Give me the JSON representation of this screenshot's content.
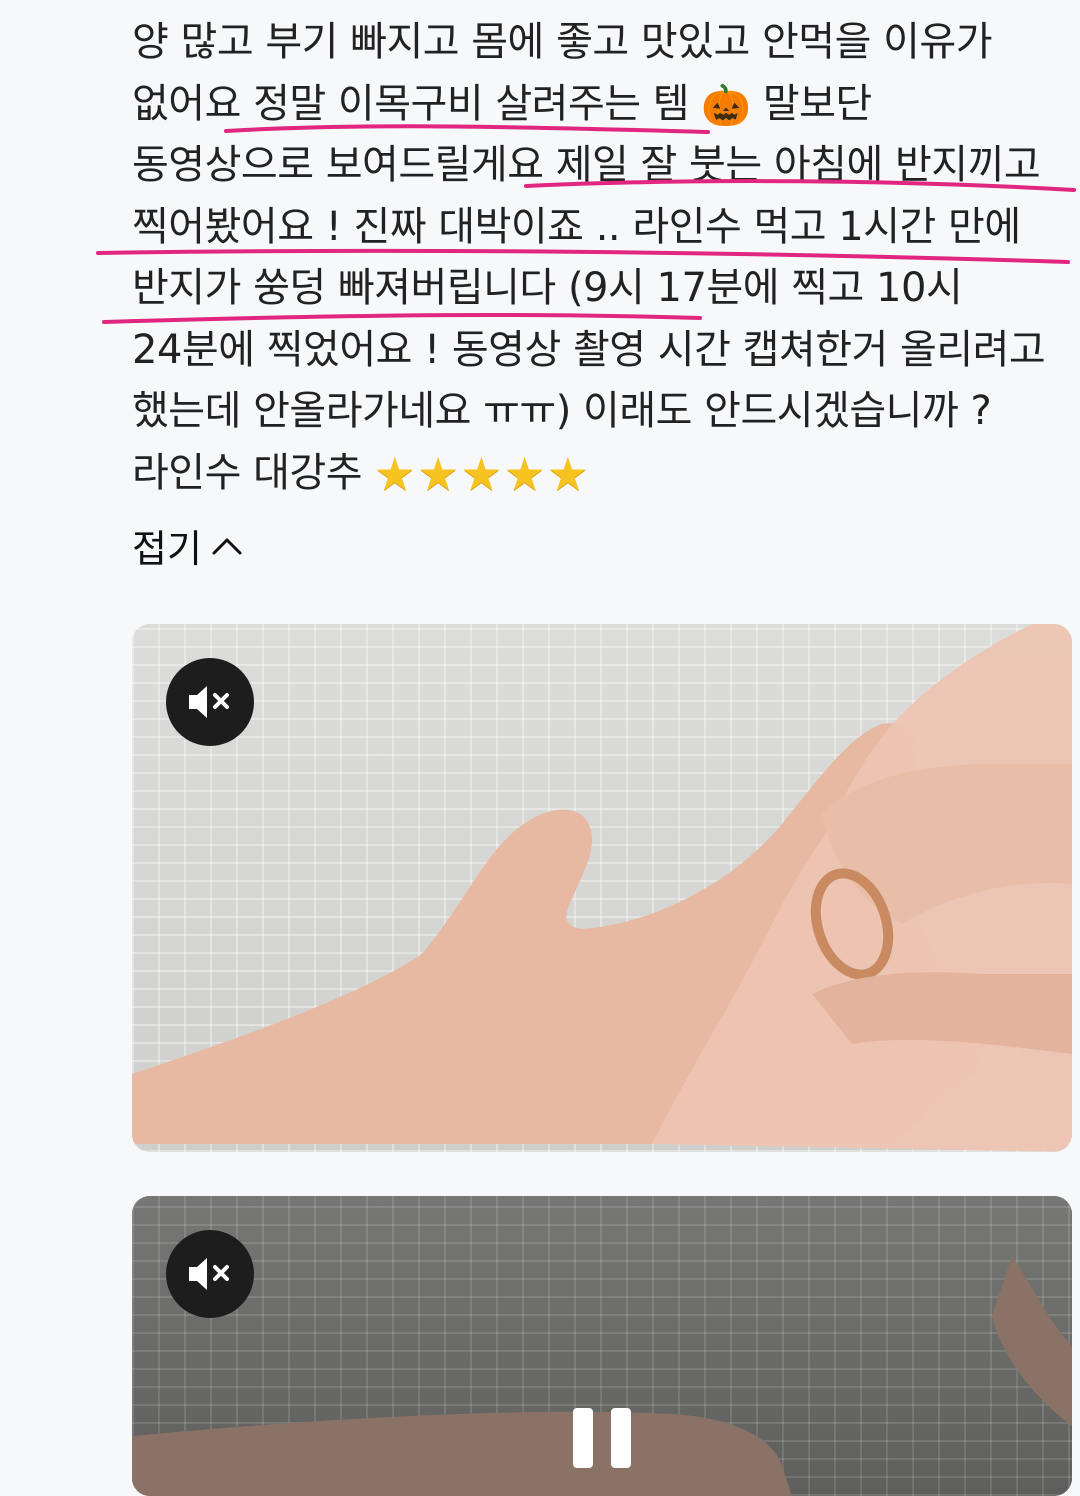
{
  "review": {
    "lines": [
      "양 많고 부기 빠지고 몸에 좋고 맛있고 안먹을 이유가",
      "없어요 정말 이목구비 살려주는 템",
      "말보단",
      "동영상으로 보여드릴게요 제일 잘 붓는 아침에 반지끼고",
      "찍어봤어요 ! 진짜 대박이죠 .. 라인수 먹고 1시간 만에",
      "반지가 쑹덩 빠져버립니다 (9시 17분에 찍고 10시",
      "24분에 찍었어요 ! 동영상 촬영 시간 캡쳐한거 올리려고",
      "했는데 안올라가네요 ㅠㅠ) 이래도 안드시겠습니까 ?",
      "라인수 대강추"
    ],
    "emoji_pumpkin": "🎃",
    "stars": "★★★★★",
    "stars_count": 5
  },
  "collapse_label": "접기",
  "highlight_color": "#e0267f",
  "videos": [
    {
      "muted": true,
      "icon": "speaker-muted-icon"
    },
    {
      "muted": true,
      "icon": "speaker-muted-icon",
      "paused_overlay": "pause-icon"
    }
  ]
}
